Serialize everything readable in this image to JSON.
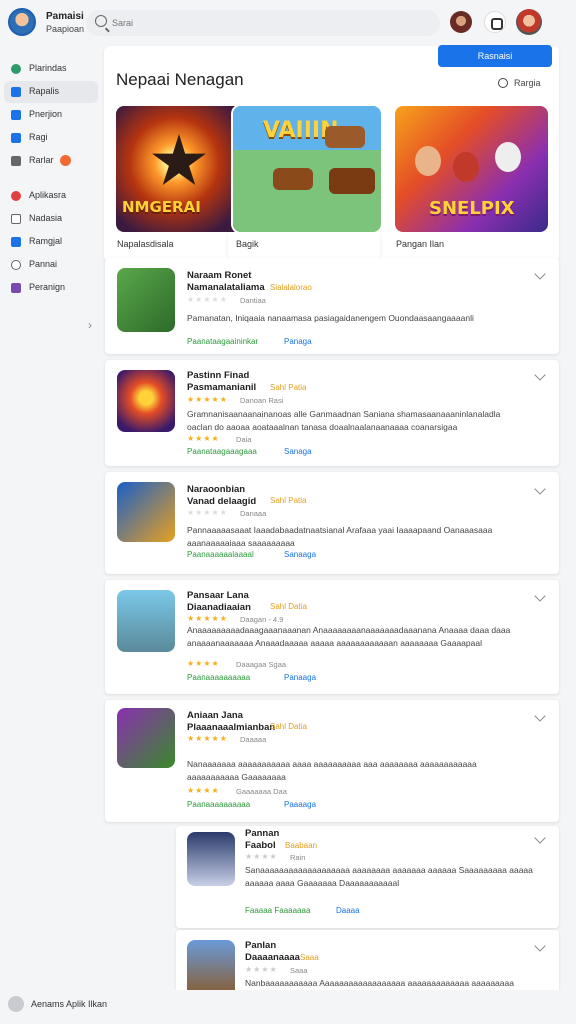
{
  "user": {
    "name": "Pamaisi",
    "subtitle": "Paapioan"
  },
  "search": {
    "placeholder": "Sarai"
  },
  "sidebar": {
    "items": [
      {
        "label": "Plarindas",
        "color": "#2e9b6a",
        "active": false
      },
      {
        "label": "Rapalis",
        "color": "#1a73e8",
        "active": true
      },
      {
        "label": "Pnerjion",
        "color": "#1a73e8",
        "active": false
      },
      {
        "label": "Ragi",
        "color": "#1a73e8",
        "active": false
      },
      {
        "label": "Rarlar",
        "color": "#666666",
        "active": false,
        "badge": true
      },
      {
        "label": "Aplikasra",
        "color": "#e04040",
        "active": false
      },
      {
        "label": "Nadasia",
        "color": "#666666",
        "active": false
      },
      {
        "label": "Ramgjal",
        "color": "#1a73e8",
        "active": false
      },
      {
        "label": "Pannai",
        "color": "#666666",
        "active": false
      },
      {
        "label": "Peranign",
        "color": "#7a4ab0",
        "active": false
      }
    ]
  },
  "main": {
    "install_label": "Rasnaisi",
    "title": "Nepaai Nenagan",
    "action_label": "Rargia",
    "cards": [
      {
        "caption": "Napalasdisala",
        "art_text": "NMGERAI"
      },
      {
        "caption": "Bagik",
        "art_text": "VAIIIN"
      },
      {
        "caption": "Pangan Ilan",
        "art_text": "SNELPIX"
      }
    ]
  },
  "apps": [
    {
      "title1": "Naraam Ronet",
      "title2": "Namanalataliama",
      "tag": "Sialalalorao",
      "rating_meta": "Dantiaa",
      "desc": "Pamanatan, Iniqaaia nanaamasa pasiagaidanengem Ouondaasaangaaaanli",
      "link_green": "Paanataagaaininkar",
      "link_blue": "Panaga"
    },
    {
      "title1": "Pastinn Finad",
      "title2": "Pasmamanianil",
      "tag": "Sahl Patia",
      "rating_meta": "Danoan Rasi",
      "desc": "Gramnanisaanaanainanoas alle Ganmaadnan Saniana shamasaanaaaninlanaladla oaclan do aaoaa aoataaalnan tanasa doaalnaalanaanaaaa coanarsigaa",
      "rating2_meta": "Daia",
      "link_green": "Paanataagaaagaaa",
      "link_blue": "Sanaga"
    },
    {
      "title1": "Naraoonbian",
      "title2": "Vanad delaagid",
      "tag": "Sahl Patia",
      "rating_meta": "Danaaa",
      "desc": "Pannaaaaasaaat Iaaadabaadatnaatsianal Arafaaa yaai Iaaaapaand Oanaaasaaa aaanaaaaaiaaa saaaaaaaaa",
      "link_green": "Paanaaaaaalaaaal",
      "link_blue": "Sanaaga"
    },
    {
      "title1": "Pansaar Lana",
      "title2": "Diaanadiaaian",
      "tag": "Sahl Datia",
      "rating_meta": "Daagan - 4.9",
      "desc": "Anaaaaaaaaadaaagaaanaaanan Anaaaaaaaanaaaaaaadaaanana Anaaaa daaa daaa anaaaanaaaaaaa Anaaadaaaaa aaaaa aaaaaaaaaaaan aaaaaaaa Gaaaapaal",
      "rating2_meta": "Daaagaa Sgaa",
      "link_green": "Paanaaaaaaaaaa",
      "link_blue": "Panaaga"
    },
    {
      "title1": "Aniaan Jana",
      "title2": "Plaaanaaalmianban",
      "tag": "Sahl Datia",
      "rating_meta": "Daaaaa",
      "desc": "Nanaaaaaaa aaaaaaaaaaa aaaa aaaaaaaaaa aaa aaaaaaaa aaaaaaaaaaaa aaaaaaaaaaa Gaaaaaaaa",
      "rating2_meta": "Gaaaaaaa Daa",
      "link_green": "Paanaaaaaaaaaa",
      "link_blue": "Paaaaga"
    },
    {
      "title1": "Pannan",
      "title2": "Faabol",
      "tag": "Baabaan",
      "rating_meta": "Rain",
      "desc": "Sanaaaaaaaaaaaaaaaaaaa aaaaaaaa aaaaaaa aaaaaa Saaaaaaaaa aaaaa aaaaaa aaaa Gaaaaaaa Daaaaaaaaaaal",
      "link_green": "Faaaaa Faaaaaaa",
      "link_blue": "Daaaa"
    },
    {
      "title1": "Panlan",
      "title2": "Daaaanaaaa",
      "tag": "Saaa",
      "rating_meta": "Saaa",
      "desc": "Nanbaaaaaaaaaaa Aaaaaaaaaaaaaaaaaa aaaaaaaaaaaaa aaaaaaaaa",
      "link_green": "",
      "link_blue": ""
    }
  ],
  "footer": {
    "text": "Aenams Aplik Ilkan"
  },
  "colors": {
    "accent": "#1a73e8",
    "green": "#2e9b3a",
    "star": "#f2b01e",
    "tag": "#e0a020"
  }
}
